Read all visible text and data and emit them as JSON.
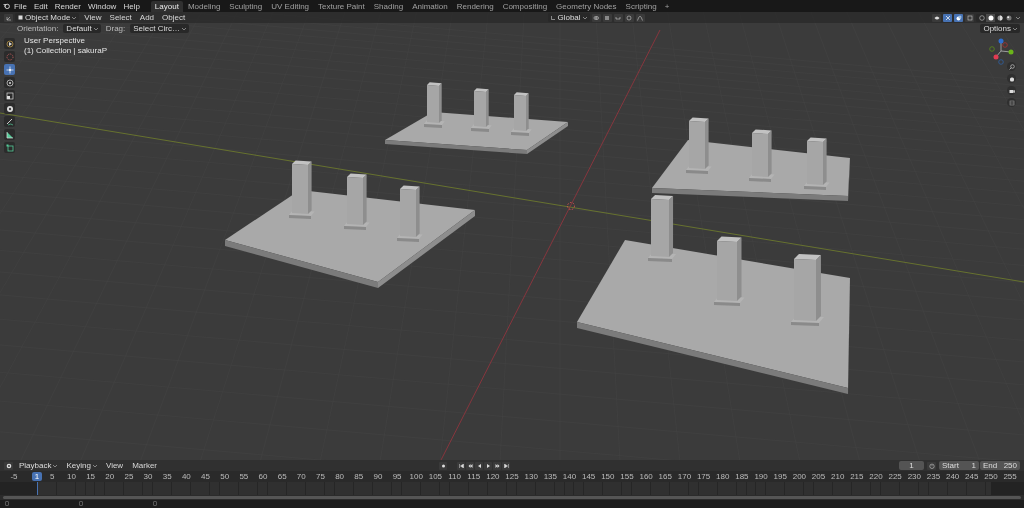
{
  "menubar": {
    "menus": [
      "File",
      "Edit",
      "Render",
      "Window",
      "Help"
    ]
  },
  "workspaces": [
    {
      "label": "Layout",
      "selected": true
    },
    {
      "label": "Modeling",
      "selected": false
    },
    {
      "label": "Sculpting",
      "selected": false
    },
    {
      "label": "UV Editing",
      "selected": false
    },
    {
      "label": "Texture Paint",
      "selected": false
    },
    {
      "label": "Shading",
      "selected": false
    },
    {
      "label": "Animation",
      "selected": false
    },
    {
      "label": "Rendering",
      "selected": false
    },
    {
      "label": "Compositing",
      "selected": false
    },
    {
      "label": "Geometry Nodes",
      "selected": false
    },
    {
      "label": "Scripting",
      "selected": false
    }
  ],
  "add_workspace": "+",
  "header": {
    "mode": "Object Mode",
    "menus": [
      "View",
      "Select",
      "Add",
      "Object"
    ],
    "orientation": "Global"
  },
  "tool_settings": {
    "orientation_label": "Orientation:",
    "orientation": "Default",
    "drag_label": "Drag:",
    "drag": "Select Circ…",
    "options": "Options"
  },
  "shading_modes": [
    {
      "kind": "wireframe",
      "selected": false
    },
    {
      "kind": "solid",
      "selected": true
    },
    {
      "kind": "material",
      "selected": false
    },
    {
      "kind": "rendered",
      "selected": false
    }
  ],
  "viewport": {
    "view_name": "User Perspective",
    "collection": "(1) Collection | sakuraP"
  },
  "tools": [
    {
      "kind": "select",
      "selected": false
    },
    {
      "kind": "cursor",
      "selected": false
    },
    {
      "kind": "move",
      "selected": true
    },
    {
      "kind": "rotate",
      "selected": false
    },
    {
      "kind": "scale",
      "selected": false
    },
    {
      "kind": "transform",
      "selected": false
    },
    {
      "kind": "annotate",
      "selected": false
    },
    {
      "kind": "measure",
      "selected": false
    },
    {
      "kind": "add-cube",
      "selected": false
    }
  ],
  "timeline": {
    "menus": [
      {
        "label": "Playback",
        "dropdown": true
      },
      {
        "label": "Keying",
        "dropdown": true
      },
      {
        "label": "View",
        "dropdown": false
      },
      {
        "label": "Marker",
        "dropdown": false
      }
    ],
    "current_frame": "1",
    "frame_field": "1",
    "start_label": "Start",
    "start": "1",
    "end_label": "End",
    "end": "250",
    "ticks": [
      "-5",
      "5",
      "10",
      "15",
      "20",
      "25",
      "30",
      "35",
      "40",
      "45",
      "50",
      "55",
      "60",
      "65",
      "70",
      "75",
      "80",
      "85",
      "90",
      "95",
      "100",
      "105",
      "110",
      "115",
      "120",
      "125",
      "130",
      "135",
      "140",
      "145",
      "150",
      "155",
      "160",
      "165",
      "170",
      "175",
      "180",
      "185",
      "190",
      "195",
      "200",
      "205",
      "210",
      "215",
      "220",
      "225",
      "230",
      "235",
      "240",
      "245",
      "250",
      "255"
    ]
  }
}
